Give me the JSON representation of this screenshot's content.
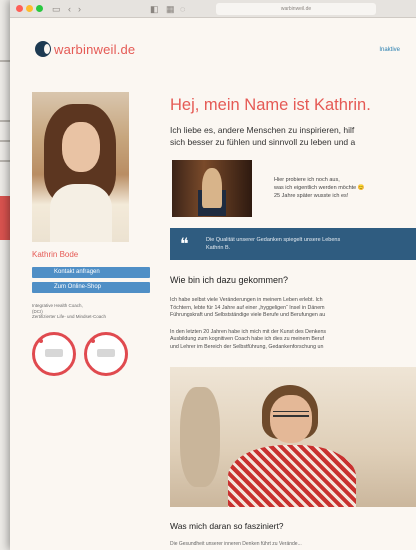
{
  "browser": {
    "url": "warbinweil.de"
  },
  "header": {
    "logo_text": "warbinweil.de",
    "nav_link": "Inaktive"
  },
  "sidebar": {
    "name": "Kathrin Bode",
    "buttons": [
      "Kontakt anfragen",
      "Zum Online-Shop"
    ],
    "qualification_text": [
      "Integrative Health Coach,",
      "(DCI)",
      "Zertifizierter Life- und Mindset-Coach"
    ]
  },
  "main": {
    "title": "Hej, mein Name ist Kathrin.",
    "intro_lines": [
      "Ich liebe es, andere Menschen zu inspirieren, hilf",
      "sich besser zu fühlen und sinnvoll zu leben und a"
    ],
    "media_caption_lines": [
      "Hier probiere ich noch aus,",
      "was ich eigentlich werden möchte 😊",
      "25 Jahre später wusste ich es!"
    ],
    "quote_lines": [
      "Die Qualität unserer Gedanken spiegelt unsere Lebens",
      "Kathrin B."
    ],
    "section1_heading": "Wie bin ich dazu gekommen?",
    "para1_lines": [
      "Ich habe selbst viele Veränderungen in meinem Leben erlebt. Ich",
      "Töchtern, lebte für 14 Jahre auf einer „hyggeligen“ Insel in Dänem",
      "Führungskraft und Selbstständige viele Berufe und Berufungen au"
    ],
    "para2_lines": [
      "In den letzten 20 Jahren habe ich mich mit der Kunst des Denkens",
      "Ausbildung zum kognitiven Coach habe ich dies zu meinem Beruf",
      "und Lehrer im Bereich der Selbstführung, Gedankenforschung un"
    ],
    "section2_heading": "Was mich daran so fasziniert?",
    "tail_text": "Die Gesundheit unserer inneren Denken führt zu Verände..."
  }
}
